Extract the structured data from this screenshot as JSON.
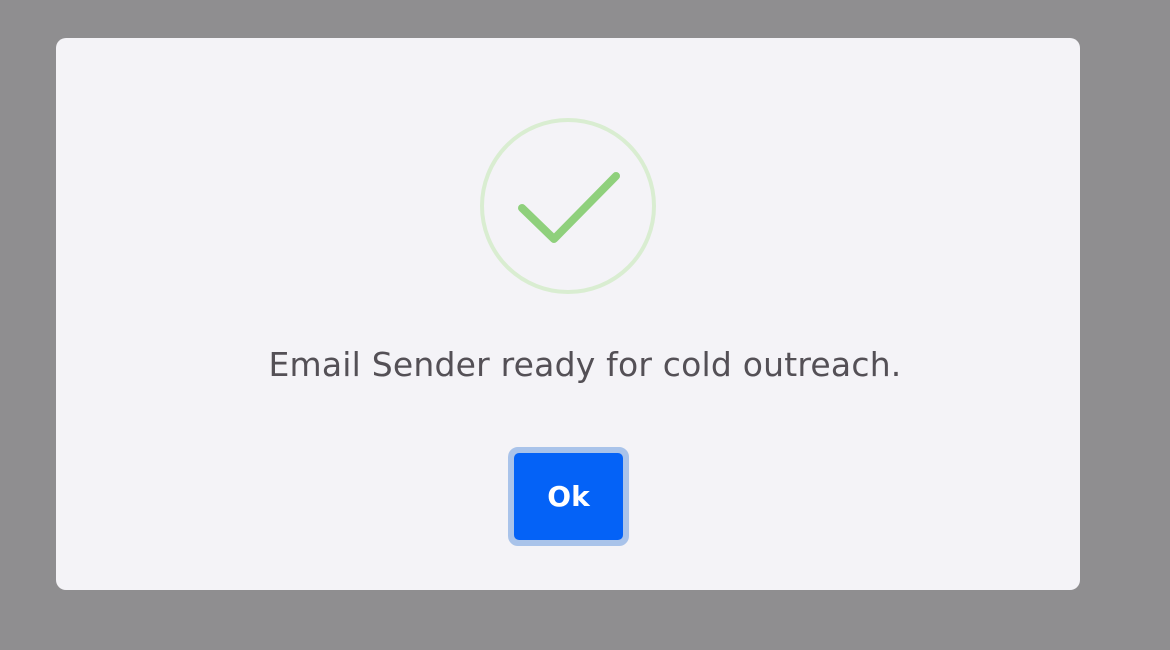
{
  "dialog": {
    "icon": "success-check-icon",
    "message": "Email Sender ready for cold outreach.",
    "ok_label": "Ok"
  },
  "colors": {
    "overlay": "#8f8e90",
    "dialog_background": "#f4f3f7",
    "check_stroke": "#8fd07c",
    "check_ring": "#d8ecd0",
    "button_fill": "#0462f7",
    "button_focus_ring": "#a9c3ea",
    "message_text": "#545056"
  }
}
